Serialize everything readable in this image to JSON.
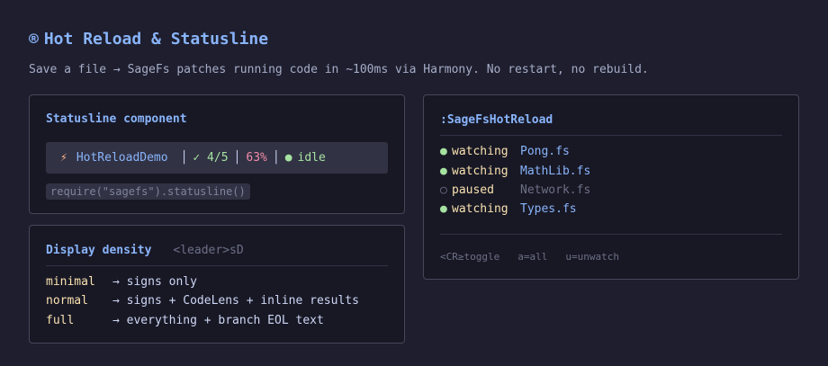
{
  "header": {
    "icon": "®",
    "title": "Hot Reload & Statusline",
    "subtitle": "Save a file → SageFs patches running code in ~100ms via Harmony. No restart, no rebuild."
  },
  "statusline": {
    "heading": "Statusline component",
    "bolt_icon": "⚡",
    "project": "HotReloadDemo",
    "separator": "│",
    "tests": "✓ 4/5",
    "coverage": "63%",
    "state_dot": "●",
    "state": "idle",
    "code": "require(\"sagefs\").statusline()"
  },
  "density": {
    "heading": "Display density",
    "keybind": "<leader>sD",
    "rows": [
      {
        "mode": "minimal",
        "desc": "→ signs only"
      },
      {
        "mode": "normal",
        "desc": "→ signs + CodeLens + inline results"
      },
      {
        "mode": "full",
        "desc": "→ everything + branch EOL text"
      }
    ]
  },
  "hotreload": {
    "heading": ":SageFsHotReload",
    "files": [
      {
        "dot": "●",
        "state": "watching",
        "file": "Pong.fs"
      },
      {
        "dot": "●",
        "state": "watching",
        "file": "MathLib.fs"
      },
      {
        "dot": "○",
        "state": "paused",
        "file": "Network.fs"
      },
      {
        "dot": "●",
        "state": "watching",
        "file": "Types.fs"
      }
    ],
    "keys": [
      "<CR≥toggle",
      "a=all",
      "u=unwatch"
    ]
  },
  "colors": {
    "background": "#1e1e2e",
    "accent": "#89b4fa",
    "green": "#a6e3a1",
    "yellow": "#f9e2af",
    "red": "#f38ba8",
    "orange": "#fab387"
  }
}
